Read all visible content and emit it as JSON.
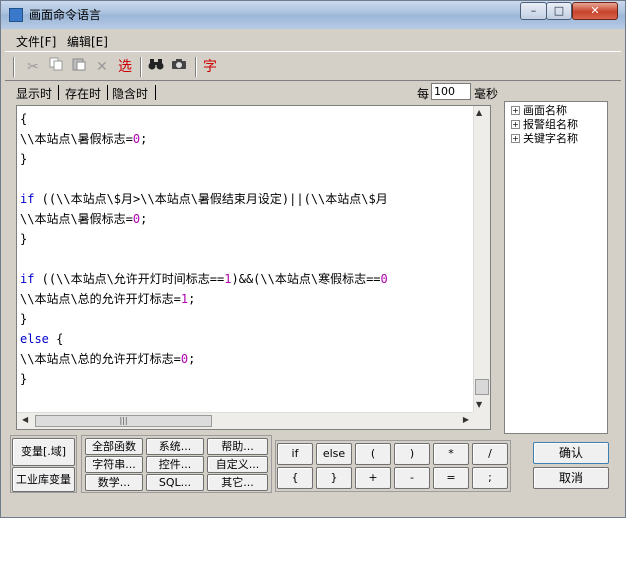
{
  "window": {
    "title": "画面命令语言"
  },
  "titlebar": {
    "min": "–",
    "max": "□",
    "close": "✕"
  },
  "menu": {
    "file": "文件[F]",
    "edit": "编辑[E]"
  },
  "toolbar": {
    "cut_icon": "scissors-icon",
    "copy_icon": "copy-icon",
    "paste_icon": "paste-icon",
    "delete_icon": "delete-icon",
    "select_label": "选",
    "find_icon": "binoculars-icon",
    "replace_icon": "replace-icon",
    "font_label": "字"
  },
  "tabs": [
    "显示时",
    "存在时",
    "隐含时"
  ],
  "interval": {
    "every_label": "每",
    "value": "100",
    "unit_label": "毫秒"
  },
  "code_lines": [
    [
      {
        "t": "{"
      }
    ],
    [
      {
        "t": "\\\\本站点\\暑假标志="
      },
      {
        "t": "0",
        "c": "num"
      },
      {
        "t": ";"
      }
    ],
    [
      {
        "t": "}"
      }
    ],
    [
      {
        "t": ""
      }
    ],
    [
      {
        "t": "if",
        "c": "kw"
      },
      {
        "t": " ((\\\\本站点\\$月>\\\\本站点\\暑假结束月设定)||(\\\\本站点\\$月"
      }
    ],
    [
      {
        "t": "\\\\本站点\\暑假标志="
      },
      {
        "t": "0",
        "c": "num"
      },
      {
        "t": ";"
      }
    ],
    [
      {
        "t": "}"
      }
    ],
    [
      {
        "t": ""
      }
    ],
    [
      {
        "t": "if",
        "c": "kw"
      },
      {
        "t": " ((\\\\本站点\\允许开灯时间标志=="
      },
      {
        "t": "1",
        "c": "num"
      },
      {
        "t": ")&&(\\\\本站点\\寒假标志=="
      },
      {
        "t": "0",
        "c": "num"
      }
    ],
    [
      {
        "t": "\\\\本站点\\总的允许开灯标志="
      },
      {
        "t": "1",
        "c": "num"
      },
      {
        "t": ";"
      }
    ],
    [
      {
        "t": "}"
      }
    ],
    [
      {
        "t": "else",
        "c": "kw"
      },
      {
        "t": " {"
      }
    ],
    [
      {
        "t": "\\\\本站点\\总的允许开灯标志="
      },
      {
        "t": "0",
        "c": "num"
      },
      {
        "t": ";"
      }
    ],
    [
      {
        "t": "}"
      }
    ]
  ],
  "tree": [
    "画面名称",
    "报警组名称",
    "关键字名称"
  ],
  "buttons": {
    "variable": "变量[.域]",
    "library_variable": "工业库变量",
    "all_functions": "全部函数",
    "system": "系统...",
    "help": "帮助...",
    "string": "字符串...",
    "control": "控件...",
    "custom": "自定义...",
    "math": "数学...",
    "sql": "SQL...",
    "other": "其它...",
    "confirm": "确认",
    "cancel": "取消"
  },
  "keypad": [
    "if",
    "else",
    "(",
    ")",
    "*",
    "/",
    "{",
    "}",
    "+",
    "-",
    "=",
    ";"
  ],
  "colors": {
    "keyword": "#0000cc",
    "number": "#b000b0",
    "select_label": "#cc0000"
  }
}
